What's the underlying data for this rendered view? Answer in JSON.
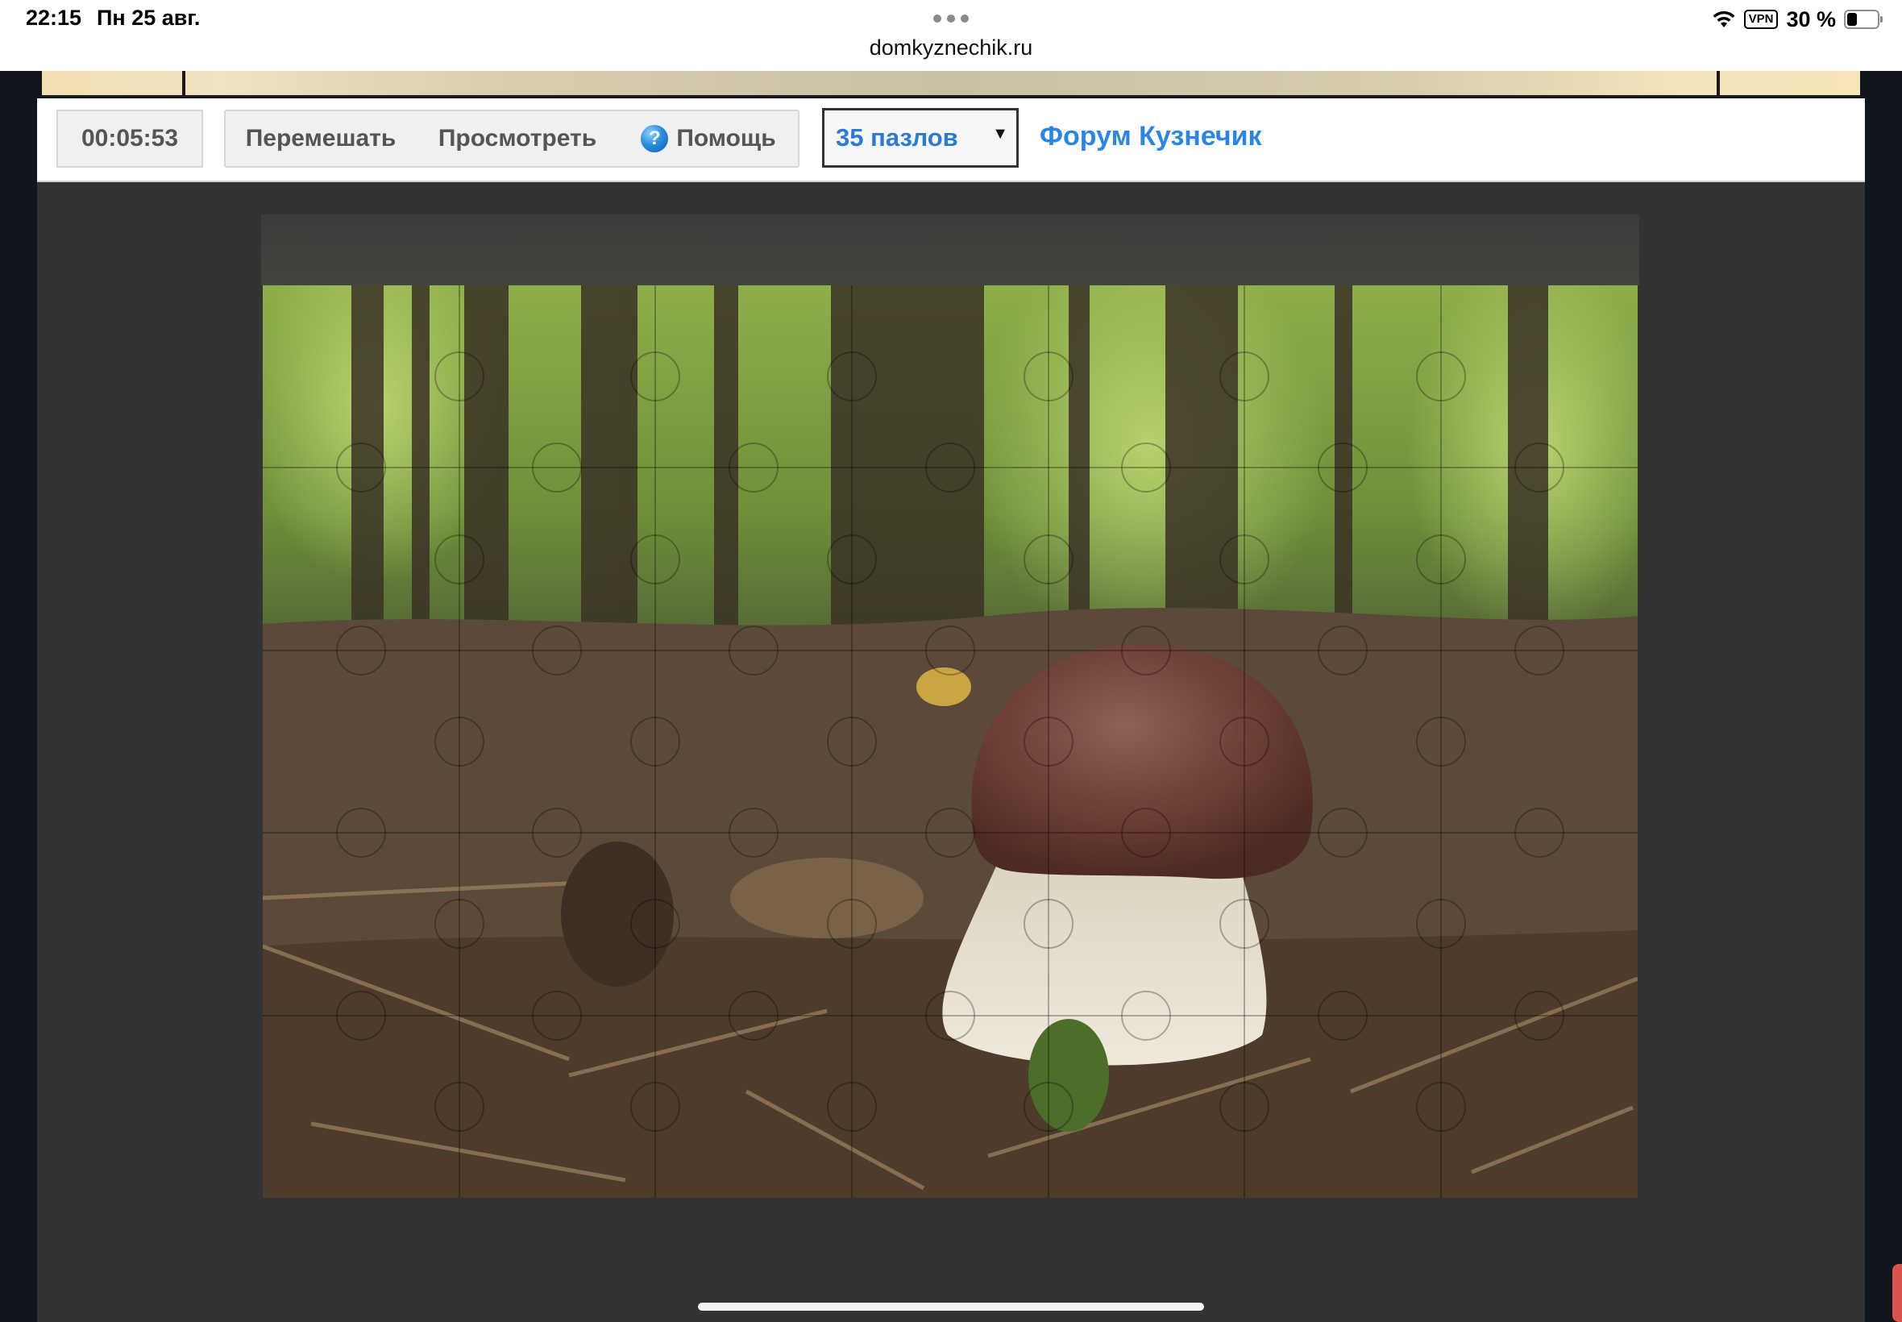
{
  "status_bar": {
    "time": "22:15",
    "date": "Пн 25 авг.",
    "url": "domkyznechik.ru",
    "vpn": "VPN",
    "battery": "30 %",
    "icons": [
      "wifi-icon",
      "battery-icon"
    ]
  },
  "toolbar": {
    "timer": "00:05:53",
    "shuffle_label": "Перемешать",
    "preview_label": "Просмотреть",
    "help_label": "Помощь",
    "help_icon": "?",
    "pieces_select_value": "35 пазлов",
    "forum_link": "Форум Кузнечик"
  },
  "puzzle": {
    "pieces": 35,
    "columns": 7,
    "rows": 5,
    "image_subject": "mushroom",
    "colors": {
      "board_bg": "#333333",
      "link_blue": "#2a86e6"
    }
  }
}
